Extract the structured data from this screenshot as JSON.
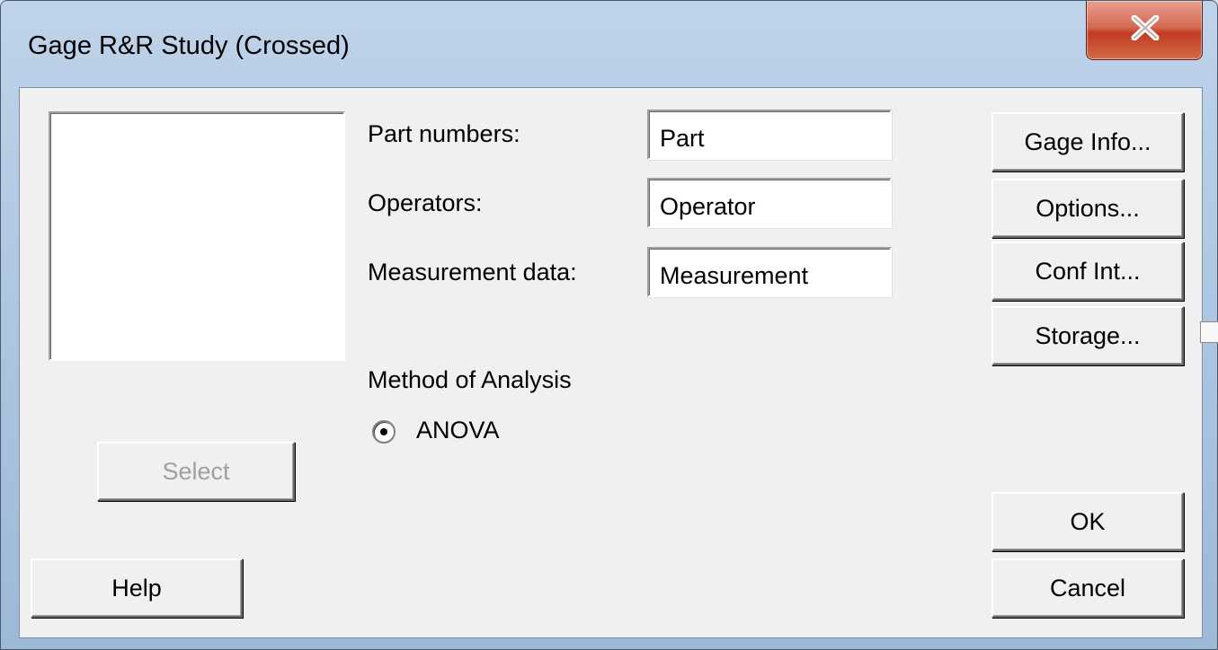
{
  "window": {
    "title": "Gage R&R Study (Crossed)"
  },
  "fields": {
    "part_numbers": {
      "label": "Part numbers:",
      "value": "Part"
    },
    "operators": {
      "label": "Operators:",
      "value": "Operator"
    },
    "measurement_data": {
      "label": "Measurement data:",
      "value": "Measurement"
    }
  },
  "method": {
    "heading": "Method of Analysis",
    "option_label": "ANOVA",
    "selected": true
  },
  "buttons": {
    "gage_info": "Gage Info...",
    "options": "Options...",
    "conf_int": "Conf Int...",
    "storage": "Storage...",
    "select": "Select",
    "help": "Help",
    "ok": "OK",
    "cancel": "Cancel"
  },
  "colors": {
    "close_button": "#c03c22",
    "dialog_background": "#f0f0f0",
    "disabled_text": "#a0a0a0"
  },
  "icons": {
    "close": "close-icon",
    "radio": "radio-selected-icon"
  }
}
